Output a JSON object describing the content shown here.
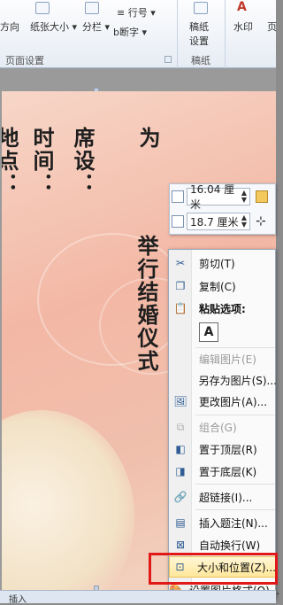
{
  "ribbon": {
    "orientation": "方向",
    "paper_size": "纸张大小",
    "columns": "分栏",
    "line_numbers": "行号",
    "hyphenation": "断字",
    "draft_paper_line1": "稿纸",
    "draft_paper_line2": "设置",
    "watermark": "水印",
    "page_color_partial": "页",
    "group_page_setup": "页面设置",
    "group_draft_paper": "稿纸"
  },
  "document": {
    "col1": "地点：",
    "col2": "时间：",
    "col3": "席设：",
    "col4_top": "为",
    "col4_bottom": "举行结婚仪式"
  },
  "mini_toolbar": {
    "height_value": "16.04 厘米",
    "width_value": "18.7 厘米"
  },
  "context_menu": {
    "cut": "剪切(T)",
    "copy": "复制(C)",
    "paste_options": "粘贴选项:",
    "paste_keep_text": "A",
    "edit_picture": "编辑图片(E)",
    "save_as_picture": "另存为图片(S)...",
    "change_picture": "更改图片(A)...",
    "group": "组合(G)",
    "bring_to_front": "置于顶层(R)",
    "send_to_back": "置于底层(K)",
    "hyperlink": "超链接(I)...",
    "insert_caption": "插入题注(N)...",
    "wrap_text": "自动换行(W)",
    "size_and_position": "大小和位置(Z)...",
    "format_picture": "设置图片格式(O)..."
  },
  "status_bar": {
    "mode": "插入"
  },
  "colors": {
    "highlight_border": "#e01818",
    "page_background": "#f3b8a5"
  }
}
